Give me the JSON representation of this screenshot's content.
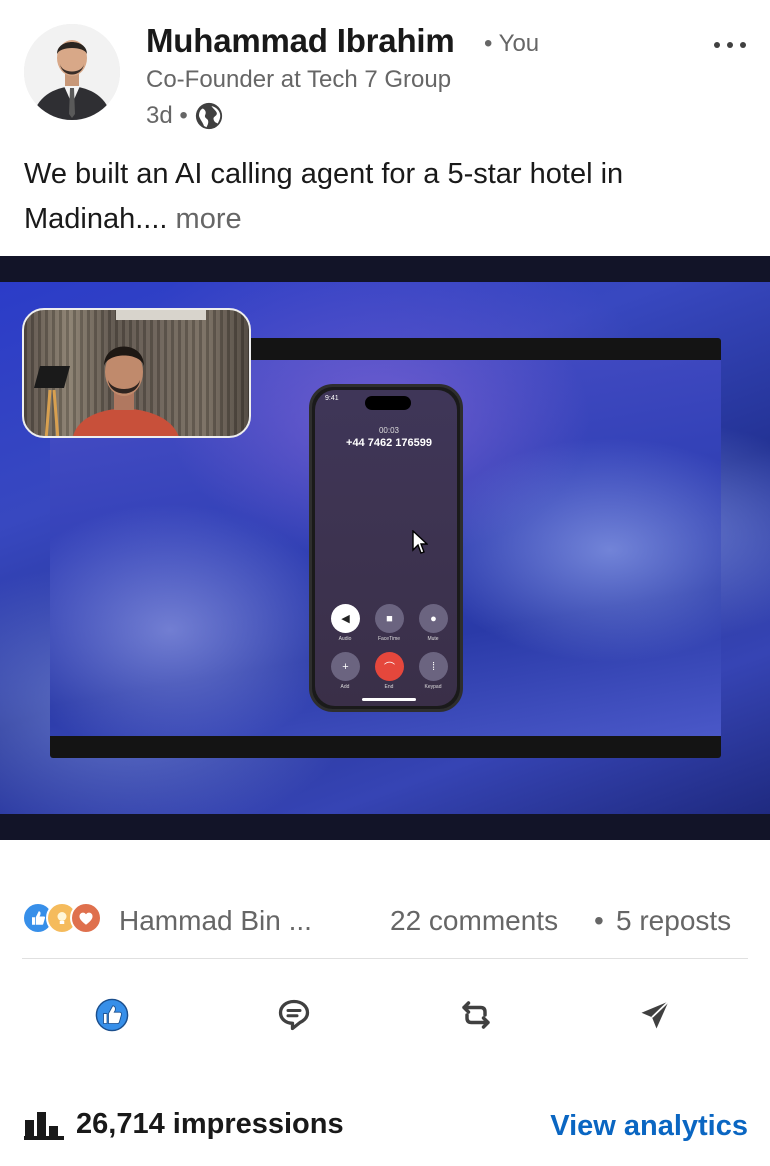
{
  "post": {
    "author": {
      "name": "Muhammad Ibrahim",
      "you_tag": "• You",
      "headline": "Co-Founder at Tech 7 Group",
      "time": "3d •"
    },
    "text": "We built an AI calling agent for a 5-star hotel in Madinah....",
    "see_more": "more"
  },
  "video": {
    "phone": {
      "status_time": "9:41",
      "call_duration": "00:03",
      "number": "+44 7462 176599",
      "controls": [
        {
          "label": "Audio",
          "icon": "speaker-icon"
        },
        {
          "label": "FaceTime",
          "icon": "video-camera-icon"
        },
        {
          "label": "Mute",
          "icon": "mic-icon"
        },
        {
          "label": "Add",
          "icon": "add-person-icon"
        },
        {
          "label": "End",
          "icon": "end-call-icon"
        },
        {
          "label": "Keypad",
          "icon": "keypad-icon"
        }
      ]
    }
  },
  "social": {
    "reactions": [
      "like-icon",
      "insightful-icon",
      "love-icon"
    ],
    "reactor_name": "Hammad Bin ...",
    "comments": "22 comments",
    "separator": "•",
    "reposts": "5 reposts"
  },
  "actions": [
    {
      "name": "like",
      "icon": "like-icon"
    },
    {
      "name": "comment",
      "icon": "comment-icon"
    },
    {
      "name": "repost",
      "icon": "repost-icon"
    },
    {
      "name": "send",
      "icon": "send-icon"
    }
  ],
  "analytics": {
    "impressions": "26,714 impressions",
    "link": "View analytics"
  },
  "colors": {
    "accent": "#0a66c2",
    "text_primary": "#191919",
    "text_secondary": "#666666",
    "end_call": "#e5473c"
  }
}
